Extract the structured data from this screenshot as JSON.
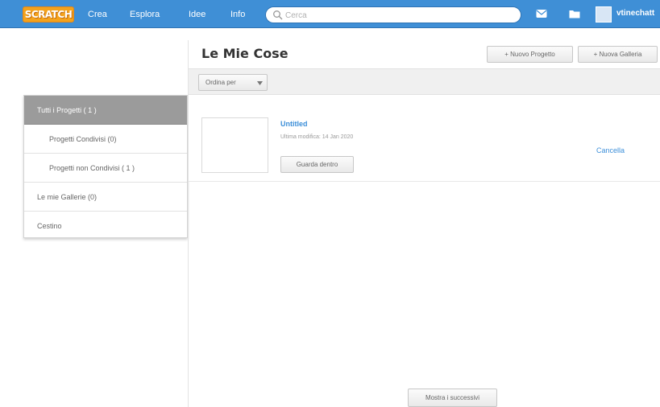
{
  "topbar": {
    "logo_text": "SCRATCH",
    "nav": [
      {
        "label": "Crea"
      },
      {
        "label": "Esplora"
      },
      {
        "label": "Idee"
      },
      {
        "label": "Info"
      }
    ],
    "search_placeholder": "Cerca",
    "username": "vtinechatt"
  },
  "page": {
    "title": "Le Mie Cose",
    "new_project_label": "+ Nuovo Progetto",
    "new_gallery_label": "+ Nuova Galleria",
    "sort_label": "Ordina per"
  },
  "sidebar": {
    "items": [
      {
        "label": "Tutti i Progetti ( 1 )",
        "active": true
      },
      {
        "label": "Progetti Condivisi (0)",
        "active": false
      },
      {
        "label": "Progetti non Condivisi ( 1 )",
        "active": false
      },
      {
        "label": "Le mie Gallerie (0)",
        "active": false
      },
      {
        "label": "Cestino",
        "active": false
      }
    ]
  },
  "projects": [
    {
      "title": "Untitled",
      "meta": "Ultima modifica: 14 Jan 2020",
      "see_inside_label": "Guarda dentro",
      "delete_label": "Cancella"
    }
  ],
  "footer": {
    "load_more_label": "Mostra i successivi"
  },
  "colors": {
    "topbar": "#3f8fd6",
    "link": "#3c8fd9",
    "sidebar_active": "#9b9b9b"
  }
}
